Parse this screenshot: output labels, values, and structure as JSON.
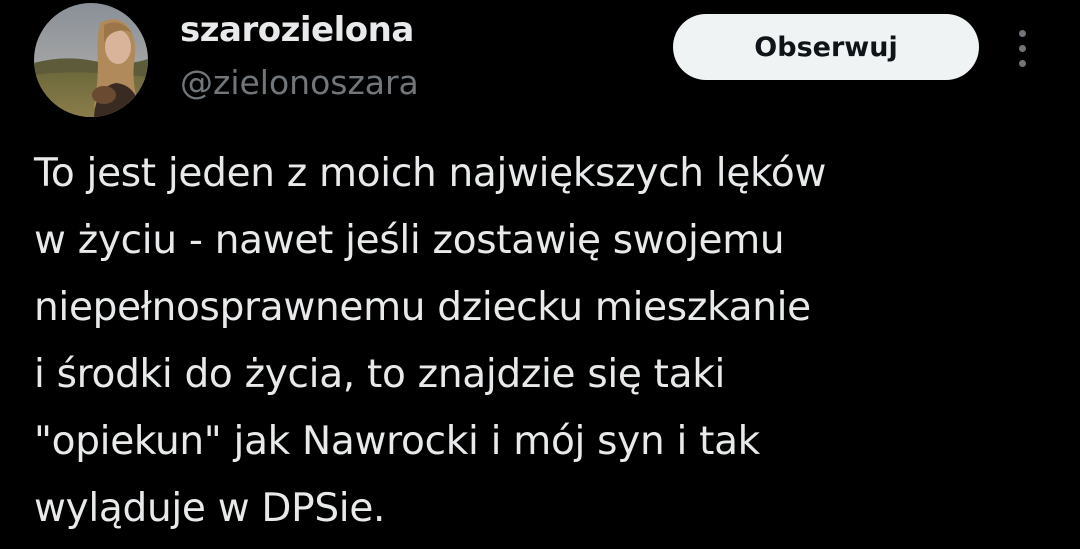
{
  "author": {
    "display_name": "szarozielona",
    "handle": "@zielonoszara"
  },
  "actions": {
    "follow_label": "Obserwuj",
    "more_icon": "more-vertical-icon"
  },
  "tweet": {
    "lines": [
      "To jest jeden z moich największych lęków",
      "w życiu - nawet jeśli zostawię swojemu",
      "niepełnosprawnemu dziecku mieszkanie",
      "i środki do życia, to znajdzie się taki",
      "\"opiekun\" jak Nawrocki i mój syn i tak",
      "wyląduje w DPSie."
    ]
  },
  "colors": {
    "background": "#000000",
    "text_primary": "#e7e9ea",
    "text_secondary": "#71767b",
    "button_bg": "#eff3f4",
    "button_text": "#0f1419"
  }
}
